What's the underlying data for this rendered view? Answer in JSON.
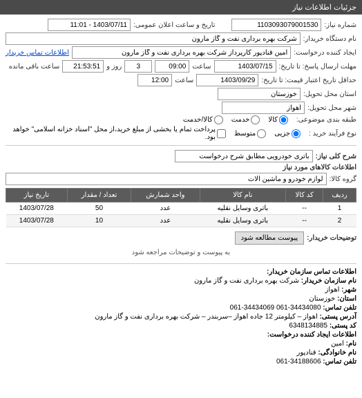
{
  "header": {
    "title": "جزئیات اطلاعات نیاز"
  },
  "fields": {
    "need_number_label": "شماره نیاز:",
    "need_number": "1103093079001530",
    "announce_date_label": "تاریخ و ساعت اعلان عمومی:",
    "announce_date": "1403/07/11 - 11:01",
    "buyer_org_label": "نام دستگاه خریدار:",
    "buyer_org": "شرکت بهره برداری نفت و گاز مارون",
    "requester_label": "ایجاد کننده درخواست:",
    "requester": "امین قنادپور کارپرداز شرکت بهره برداری نفت و گاز مارون",
    "buyer_contact_link": "اطلاعات تماس خریدار",
    "deadline_label": "مهلت ارسال پاسخ: تا تاریخ:",
    "deadline_date": "1403/07/15",
    "time_label": "ساعت",
    "deadline_time": "09:00",
    "days_label": "روز و",
    "days_value": "3",
    "remaining_label": "ساعت باقی مانده",
    "remaining_time": "21:53:51",
    "validity_label": "حداقل تاریخ اعتبار قیمت: تا تاریخ:",
    "validity_date": "1403/09/29",
    "validity_time": "12:00",
    "delivery_province_label": "استان محل تحویل:",
    "delivery_province": "خوزستان",
    "delivery_city_label": "شهر محل تحویل:",
    "delivery_city": "اهواز",
    "classification_label": "طبقه بندی موضوعی:",
    "class_goods": "کالا",
    "class_service": "خدمت",
    "class_goods_service": "کالا/خدمت",
    "purchase_type_label": "نوع فرآیند خرید :",
    "type_small": "جزیی",
    "type_medium": "متوسط",
    "type_note": "پرداخت تمام یا بخشی از مبلغ خرید،از محل \"اسناد خزانه اسلامی\" خواهد بود.",
    "need_desc_label": "شرح کلی نیاز:",
    "need_desc": "باتری خودرویی مطابق شرح درخواست",
    "items_title": "اطلاعات کالاهای مورد نیاز",
    "group_label": "گروه کالا:",
    "group_value": "لوازم خودرو و ماشین آلات"
  },
  "table": {
    "headers": {
      "row": "ردیف",
      "code": "کد کالا",
      "name": "نام کالا",
      "unit": "واحد شمارش",
      "qty": "تعداد / مقدار",
      "date": "تاریخ نیاز"
    },
    "rows": [
      {
        "row": "1",
        "code": "--",
        "name": "باتری وسایل نقلیه",
        "unit": "عدد",
        "qty": "50",
        "date": "1403/07/28"
      },
      {
        "row": "2",
        "code": "--",
        "name": "باتری وسایل نقلیه",
        "unit": "عدد",
        "qty": "10",
        "date": "1403/07/28"
      }
    ]
  },
  "attachments": {
    "label": "توضیحات خریدار:",
    "button": "پیوست مطالعه شود",
    "note": "به پیوست و توضیحات مراجعه شود"
  },
  "contact": {
    "title": "اطلاعات تماس سازمان خریدار:",
    "org_label": "نام سازمان خریدار:",
    "org": "شرکت بهره برداری نفت و گاز مارون",
    "city_label": "شهر:",
    "city": "اهواز",
    "province_label": "استان:",
    "province": "خوزستان",
    "phone_label": "تلفن تماس:",
    "phone": "34434080-061 34434069-061",
    "address_label": "آدرس پستی:",
    "address": "اهواز – کیلومتر 12 جاده اهواز –سربندر – شرکت بهره برداری نفت و گاز مارون",
    "postal_label": "کد پستی:",
    "postal": "6348134885",
    "requester_title": "اطلاعات ایجاد کننده درخواست:",
    "fname_label": "نام:",
    "fname": "امین",
    "lname_label": "نام خانوادگی:",
    "lname": "قنادپور",
    "rphone_label": "تلفن تماس:",
    "rphone": "34188606-061"
  }
}
